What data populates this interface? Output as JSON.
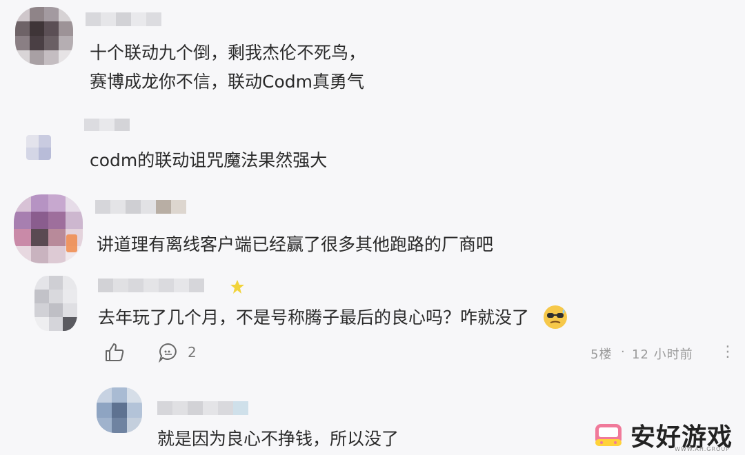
{
  "comments": [
    {
      "lines": [
        "十个联动九个倒，剩我杰伦不死鸟，",
        "赛博成龙你不信，联动Codm真勇气"
      ]
    },
    {
      "lines": [
        "codm的联动诅咒魔法果然强大"
      ]
    },
    {
      "lines": [
        "讲道理有离线客户端已经赢了很多其他跑路的厂商吧"
      ]
    },
    {
      "lines": [
        "去年玩了几个月，不是号称腾子最后的良心吗？咋就没了"
      ],
      "emoji": "sunglasses-sweat-emoji",
      "toolbar": {
        "like_icon": "thumbs-up-icon",
        "reply_icon": "comment-bubble-icon",
        "reply_count": "2"
      },
      "meta": {
        "floor": "5楼",
        "separator": "·",
        "time": "12 小时前",
        "more": "⋮"
      }
    },
    {
      "lines": [
        "就是因为良心不挣钱，所以没了"
      ]
    }
  ],
  "watermark": {
    "text": "安好游戏",
    "sub": "WWW.AH.GROUP",
    "icon": "gamepad-logo-icon"
  },
  "colors": {
    "background": "#f7f7f9",
    "text": "#2a2a2a",
    "meta": "#9a9a9a",
    "logo_pink": "#f07a9a",
    "logo_yellow": "#ffd23a"
  }
}
